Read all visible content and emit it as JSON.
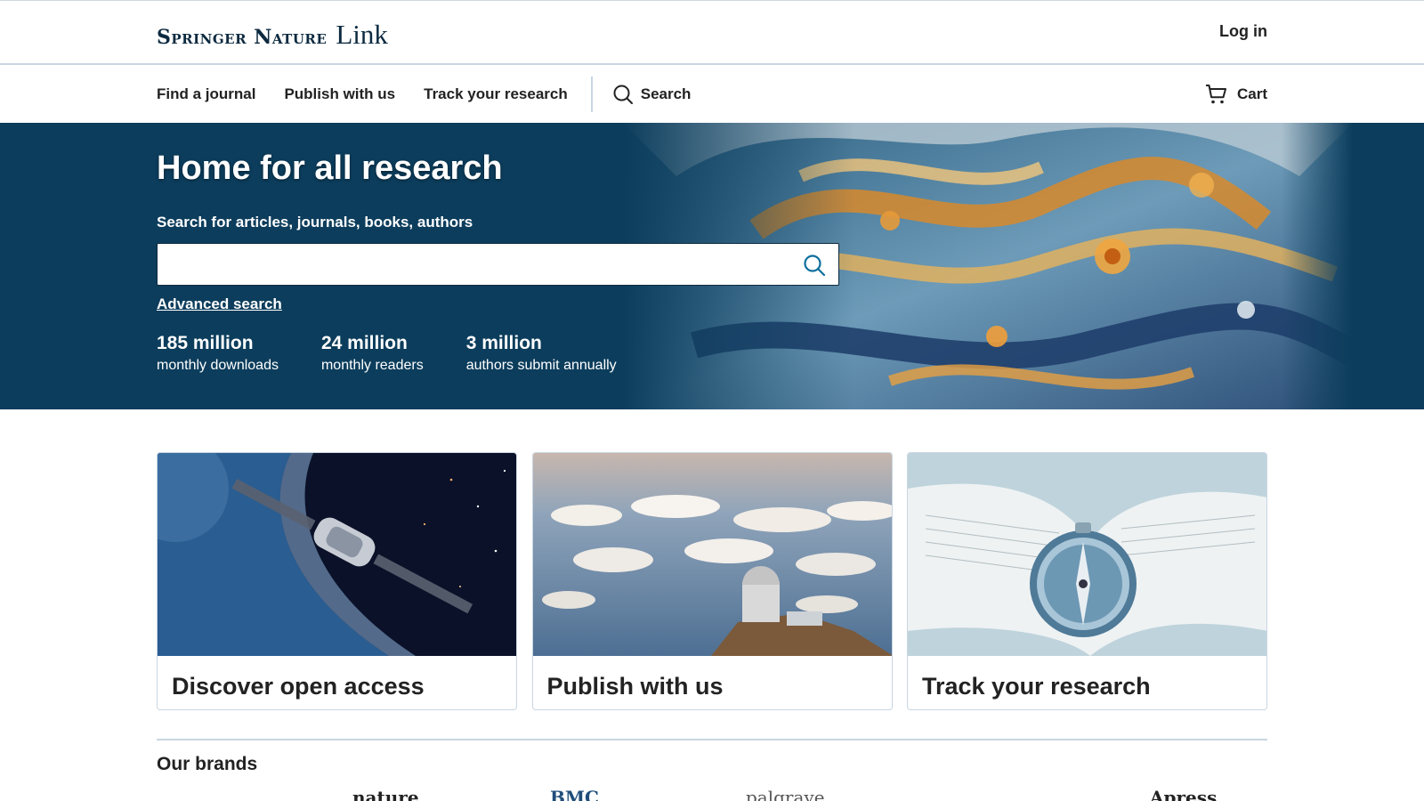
{
  "header": {
    "brand": "Springer Nature",
    "product": "Link",
    "login_label": "Log in"
  },
  "nav": {
    "items": [
      {
        "label": "Find a journal"
      },
      {
        "label": "Publish with us"
      },
      {
        "label": "Track your research"
      }
    ],
    "search_label": "Search",
    "cart_label": "Cart"
  },
  "hero": {
    "title": "Home for all research",
    "search_label": "Search for articles, journals, books, authors",
    "search_value": "",
    "advanced_search": "Advanced search",
    "stats": [
      {
        "value": "185 million",
        "label": "monthly downloads"
      },
      {
        "value": "24 million",
        "label": "monthly readers"
      },
      {
        "value": "3 million",
        "label": "authors submit annually"
      }
    ]
  },
  "cards": [
    {
      "title": "Discover open access",
      "image": "spacecraft-earth"
    },
    {
      "title": "Publish with us",
      "image": "observatory-clouds"
    },
    {
      "title": "Track your research",
      "image": "compass-book"
    }
  ],
  "brands": {
    "title": "Our brands",
    "logos": [
      "nature",
      "BMC",
      "palgrave",
      "Apress"
    ]
  },
  "colors": {
    "hero_bg": "#0c3d5c",
    "brand_dark": "#0c2a40",
    "divider": "#c9d6e2"
  }
}
